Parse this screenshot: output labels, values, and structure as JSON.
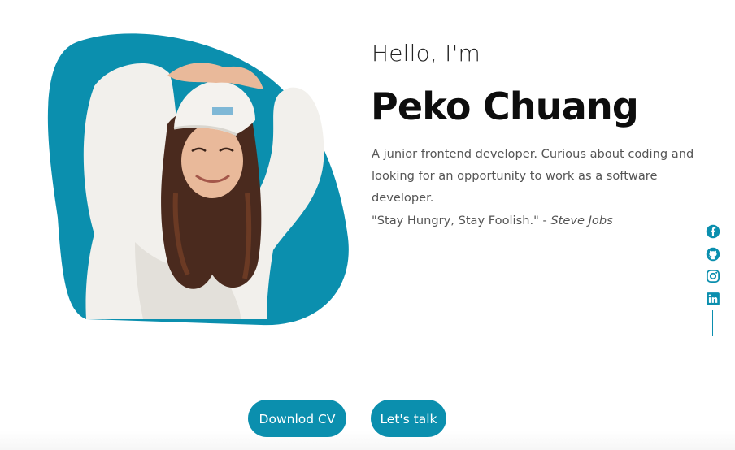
{
  "hero": {
    "greeting": "Hello, I'm",
    "name": "Peko Chuang",
    "description": "A junior frontend developer. Curious about coding and looking for an opportunity to work as a software developer.",
    "quote_text": "\"Stay Hungry, Stay Foolish.\" - ",
    "quote_author": "Steve Jobs"
  },
  "socials": [
    {
      "icon": "facebook-icon"
    },
    {
      "icon": "github-icon"
    },
    {
      "icon": "instagram-icon"
    },
    {
      "icon": "linkedin-icon"
    }
  ],
  "buttons": {
    "cv_label": "Downlod CV",
    "talk_label": "Let's talk"
  },
  "colors": {
    "accent": "#0b8fae",
    "background": "#ffffff",
    "heading": "#0d0d0d",
    "body_text": "#555555"
  }
}
